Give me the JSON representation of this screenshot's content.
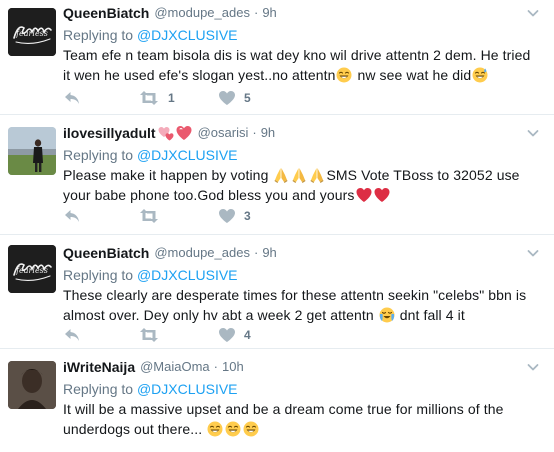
{
  "tweets": [
    {
      "name": "QueenBiatch",
      "handle": "@modupe_ades",
      "time": "9h",
      "reply_label": "Replying to",
      "reply_to": "@DJXCLUSIVE",
      "text_a": "Team efe n team bisola dis is wat dey kno wil drive attentn 2 dem. He tried it wen he used efe's slogan yest..no attentn",
      "text_b": " nw see wat he did",
      "retweets": "1",
      "likes": "5",
      "avatar": "fearless-logo"
    },
    {
      "name": "ilovesillyadult",
      "handle": "@osarisi",
      "time": "9h",
      "reply_label": "Replying to",
      "reply_to": "@DJXCLUSIVE",
      "text_a": "Please make it happen by voting ",
      "text_b": "SMS Vote TBoss to 32052 use your babe phone too.God bless you and yours",
      "retweets": "",
      "likes": "3",
      "avatar": "photo"
    },
    {
      "name": "QueenBiatch",
      "handle": "@modupe_ades",
      "time": "9h",
      "reply_label": "Replying to",
      "reply_to": "@DJXCLUSIVE",
      "text_a": "These clearly are desperate times for these attentn seekin \"celebs\" bbn is almost over. Dey only hv abt a week 2 get attentn ",
      "text_b": " dnt fall 4 it",
      "retweets": "",
      "likes": "4",
      "avatar": "fearless-logo"
    },
    {
      "name": "iWriteNaija",
      "handle": "@MaiaOma",
      "time": "10h",
      "reply_label": "Replying to",
      "reply_to": "@DJXCLUSIVE",
      "text_a": "It will be a massive upset and be a dream come true for millions of the underdogs out there... ",
      "text_b": "",
      "retweets": "",
      "likes": "",
      "avatar": "dark-photo"
    }
  ],
  "dot": "·",
  "avatar_logo_text": "fearless",
  "icons": {
    "reply": "reply-arrow-icon",
    "retweet": "retweet-icon",
    "like": "heart-icon",
    "menu": "chevron-down-icon"
  },
  "colors": {
    "link": "#1da1f2",
    "muted": "#657786",
    "text": "#14171a",
    "icon": "#aab8c2",
    "divider": "#e6ecf0",
    "heart_red": "#e0245e"
  }
}
